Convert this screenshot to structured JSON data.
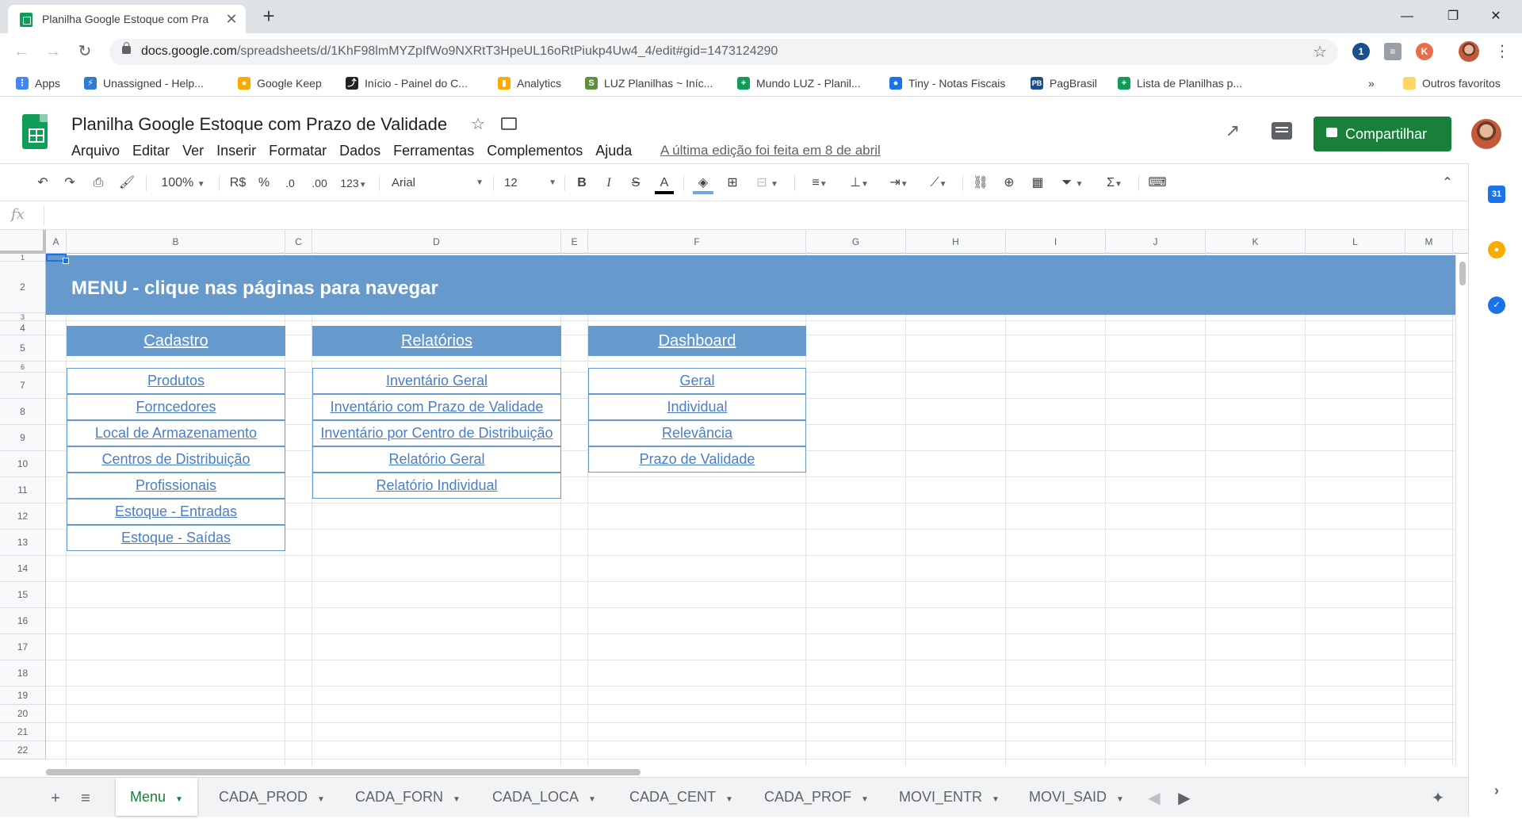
{
  "browser": {
    "tab_title": "Planilha Google Estoque com Pra",
    "url_host": "docs.google.com",
    "url_path": "/spreadsheets/d/1KhF98lmMYZpIfWo9NXRtT3HpeUL16oRtPiukp4Uw4_4/edit#gid=1473124290",
    "bookmarks": [
      {
        "label": "Apps",
        "color": "#ea4335",
        "glyph": "⋮⋮"
      },
      {
        "label": "Unassigned - Help...",
        "color": "#2f7bd1",
        "glyph": "⚡"
      },
      {
        "label": "Google Keep",
        "color": "#f9ab00",
        "glyph": "●"
      },
      {
        "label": "Início - Painel do C...",
        "color": "#202124",
        "glyph": "⤴"
      },
      {
        "label": "Analytics",
        "color": "#f9ab00",
        "glyph": "▮"
      },
      {
        "label": "LUZ Planilhas ~ Iníc...",
        "color": "#5e8e3e",
        "glyph": "S"
      },
      {
        "label": "Mundo LUZ - Planil...",
        "color": "#0f9d58",
        "glyph": "+"
      },
      {
        "label": "Tiny - Notas Fiscais",
        "color": "#1a73e8",
        "glyph": "●"
      },
      {
        "label": "PagBrasil",
        "color": "#1a4f8a",
        "glyph": "PB"
      },
      {
        "label": "Lista de Planilhas p...",
        "color": "#0f9d58",
        "glyph": "+"
      }
    ],
    "overflow": "»",
    "other_bookmarks": "Outros favoritos"
  },
  "sheets": {
    "doc_title": "Planilha Google Estoque com Prazo de Validade",
    "menu": [
      "Arquivo",
      "Editar",
      "Ver",
      "Inserir",
      "Formatar",
      "Dados",
      "Ferramentas",
      "Complementos",
      "Ajuda"
    ],
    "last_edit": "A última edição foi feita em 8 de abril",
    "share_label": "Compartilhar"
  },
  "toolbar": {
    "zoom": "100%",
    "currency": "R$",
    "percent": "%",
    "dec_less": ".0",
    "dec_more": ".00",
    "format_more": "123",
    "font": "Arial",
    "font_size": "12"
  },
  "grid": {
    "columns": [
      "A",
      "B",
      "C",
      "D",
      "E",
      "F",
      "G",
      "H",
      "I",
      "J",
      "K",
      "L",
      "M"
    ],
    "rows": [
      "1",
      "2",
      "3",
      "4",
      "5",
      "6",
      "7",
      "8",
      "9",
      "10",
      "11",
      "12",
      "13",
      "14",
      "15",
      "16",
      "17",
      "18",
      "19",
      "20",
      "21",
      "22"
    ],
    "banner": "MENU - clique nas páginas para navegar",
    "groups": [
      {
        "header": "Cadastro",
        "items": [
          "Produtos",
          "Forncedores",
          "Local de Armazenamento",
          "Centros de Distribuição",
          "Profissionais",
          "Estoque - Entradas",
          "Estoque - Saídas"
        ]
      },
      {
        "header": "Relatórios",
        "items": [
          "Inventário Geral",
          "Inventário com Prazo de Validade",
          "Inventário por Centro de Distribuição",
          "Relatório Geral",
          "Relatório Individual"
        ]
      },
      {
        "header": "Dashboard",
        "items": [
          "Geral",
          "Individual",
          "Relevância",
          "Prazo de Validade"
        ]
      }
    ]
  },
  "sheet_tabs": [
    "Menu",
    "CADA_PROD",
    "CADA_FORN",
    "CADA_LOCA",
    "CADA_CENT",
    "CADA_PROF",
    "MOVI_ENTR",
    "MOVI_SAID"
  ],
  "colors": {
    "accent_green": "#188038",
    "menu_blue": "#6699cc",
    "link_blue": "#4a7ec5"
  }
}
